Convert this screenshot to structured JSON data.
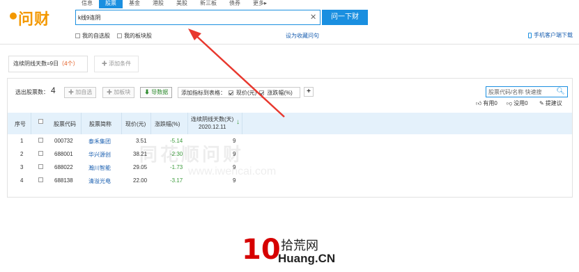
{
  "nav": {
    "tabs": [
      "信息",
      "股票",
      "基金",
      "港股",
      "美股",
      "新三板",
      "债券",
      "更多▸"
    ],
    "active_tab": 1
  },
  "search": {
    "query": "k线9连阴",
    "submit_label": "问一下财"
  },
  "options": {
    "my_watchlist": "我的自选股",
    "my_sectors": "我的板块股",
    "set_homepage": "设为收藏问句",
    "mobile_download": "手机客户端下载"
  },
  "condition": {
    "label": "连续阴线天数=9日",
    "count": "（4个）",
    "add_label": "添加条件"
  },
  "toolbar": {
    "selected_label": "选出股票数：",
    "selected_count": "4",
    "add_watch": "加自选",
    "add_sector": "加板块",
    "export": "导数据",
    "add_columns_label": "添加指标到表格：",
    "col_price": "现价(元)",
    "col_change": "涨跌幅(%)",
    "quick_search_placeholder": "股票代码/名称 快速搜",
    "useful": "有用0",
    "useless": "没用0",
    "suggest": "提建议"
  },
  "table": {
    "headers": {
      "index": "序号",
      "code": "股票代码",
      "name": "股票简称",
      "price": "现价(元)",
      "change": "涨跌幅(%)",
      "days": "连续阴线天数(天)",
      "days_date": "2020.12.11"
    },
    "rows": [
      {
        "index": "1",
        "code": "000732",
        "name": "泰禾集团",
        "price": "3.51",
        "change": "-5.14",
        "days": "9"
      },
      {
        "index": "2",
        "code": "688001",
        "name": "华兴源创",
        "price": "38.21",
        "change": "-2.30",
        "days": "9"
      },
      {
        "index": "3",
        "code": "688022",
        "name": "瀚川智能",
        "price": "29.05",
        "change": "-1.73",
        "days": "9"
      },
      {
        "index": "4",
        "code": "688138",
        "name": "清溢光电",
        "price": "22.00",
        "change": "-3.17",
        "days": "9"
      }
    ]
  },
  "watermark": {
    "line1": "同花顺问财",
    "line2": "www.iwencai.com"
  },
  "brand": {
    "logo_text": "问财",
    "footer_num": "10",
    "footer_cn": "拾荒网",
    "footer_en": "Huang.CN"
  },
  "colors": {
    "accent": "#1a8fe0",
    "negative": "#3a9a3a",
    "arrow": "#e8382e",
    "footer_red": "#d60000"
  }
}
